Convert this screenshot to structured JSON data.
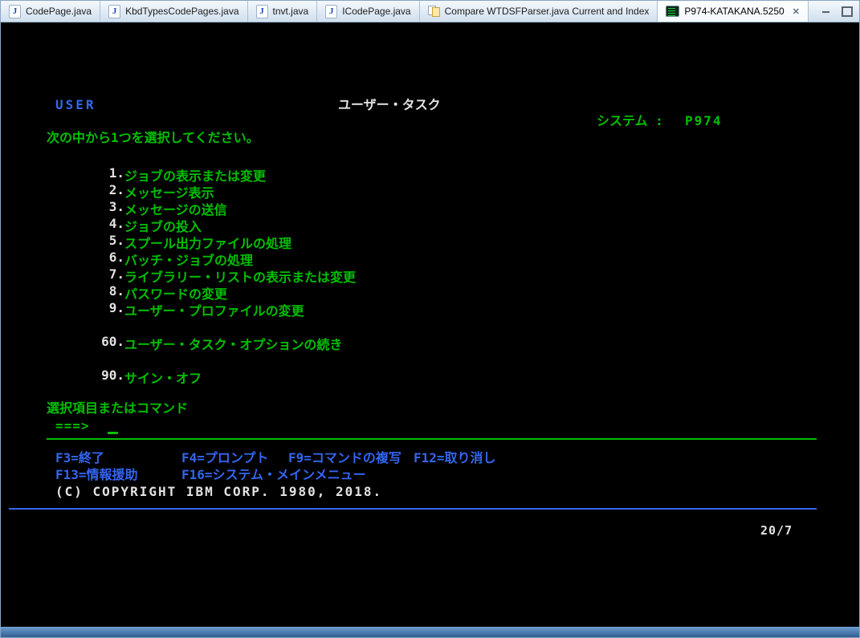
{
  "tabs": [
    {
      "label": "CodePage.java",
      "icon": "java-file-icon"
    },
    {
      "label": "KbdTypesCodePages.java",
      "icon": "java-file-icon"
    },
    {
      "label": "tnvt.java",
      "icon": "java-file-icon"
    },
    {
      "label": "ICodePage.java",
      "icon": "java-file-icon"
    },
    {
      "label": "Compare WTDSFParser.java Current and Index",
      "icon": "compare-icon"
    },
    {
      "label": "P974-KATAKANA.5250",
      "icon": "session-icon"
    }
  ],
  "icons": {
    "java_file_letter": "J",
    "close_glyph": "✕"
  },
  "terminal": {
    "user_label": "USER",
    "screen_title": "ユーザー・タスク",
    "system_label": "システム :",
    "system_name": "P974",
    "instruction": "次の中から1つを選択してください。",
    "menu_items": [
      {
        "number": "1.",
        "label": "ジョブの表示または変更"
      },
      {
        "number": "2.",
        "label": "メッセージ表示"
      },
      {
        "number": "3.",
        "label": "メッセージの送信"
      },
      {
        "number": "4.",
        "label": "ジョブの投入"
      },
      {
        "number": "5.",
        "label": "スプール出力ファイルの処理"
      },
      {
        "number": "6.",
        "label": "バッチ・ジョブの処理"
      },
      {
        "number": "7.",
        "label": "ライブラリー・リストの表示または変更"
      },
      {
        "number": "8.",
        "label": "パスワードの変更"
      },
      {
        "number": "9.",
        "label": "ユーザー・プロファイルの変更"
      },
      {
        "number": "60.",
        "label": "ユーザー・タスク・オプションの続き"
      },
      {
        "number": "90.",
        "label": "サイン・オフ"
      }
    ],
    "selection_label": "選択項目またはコマンド",
    "command_prompt": "===>",
    "function_keys_row1": [
      {
        "label": "F3=終了"
      },
      {
        "label": "F4=プロンプト"
      },
      {
        "label": "F9=コマンドの複写"
      },
      {
        "label": "F12=取り消し"
      }
    ],
    "function_keys_row2": [
      {
        "label": "F13=情報援助"
      },
      {
        "label": "F16=システム・メインメニュー"
      }
    ],
    "copyright": "(C) COPYRIGHT IBM CORP. 1980, 2018.",
    "cursor_position": "20/7"
  },
  "colors": {
    "green": "#00c000",
    "blue": "#3366f0",
    "white": "#e2e2e2"
  }
}
